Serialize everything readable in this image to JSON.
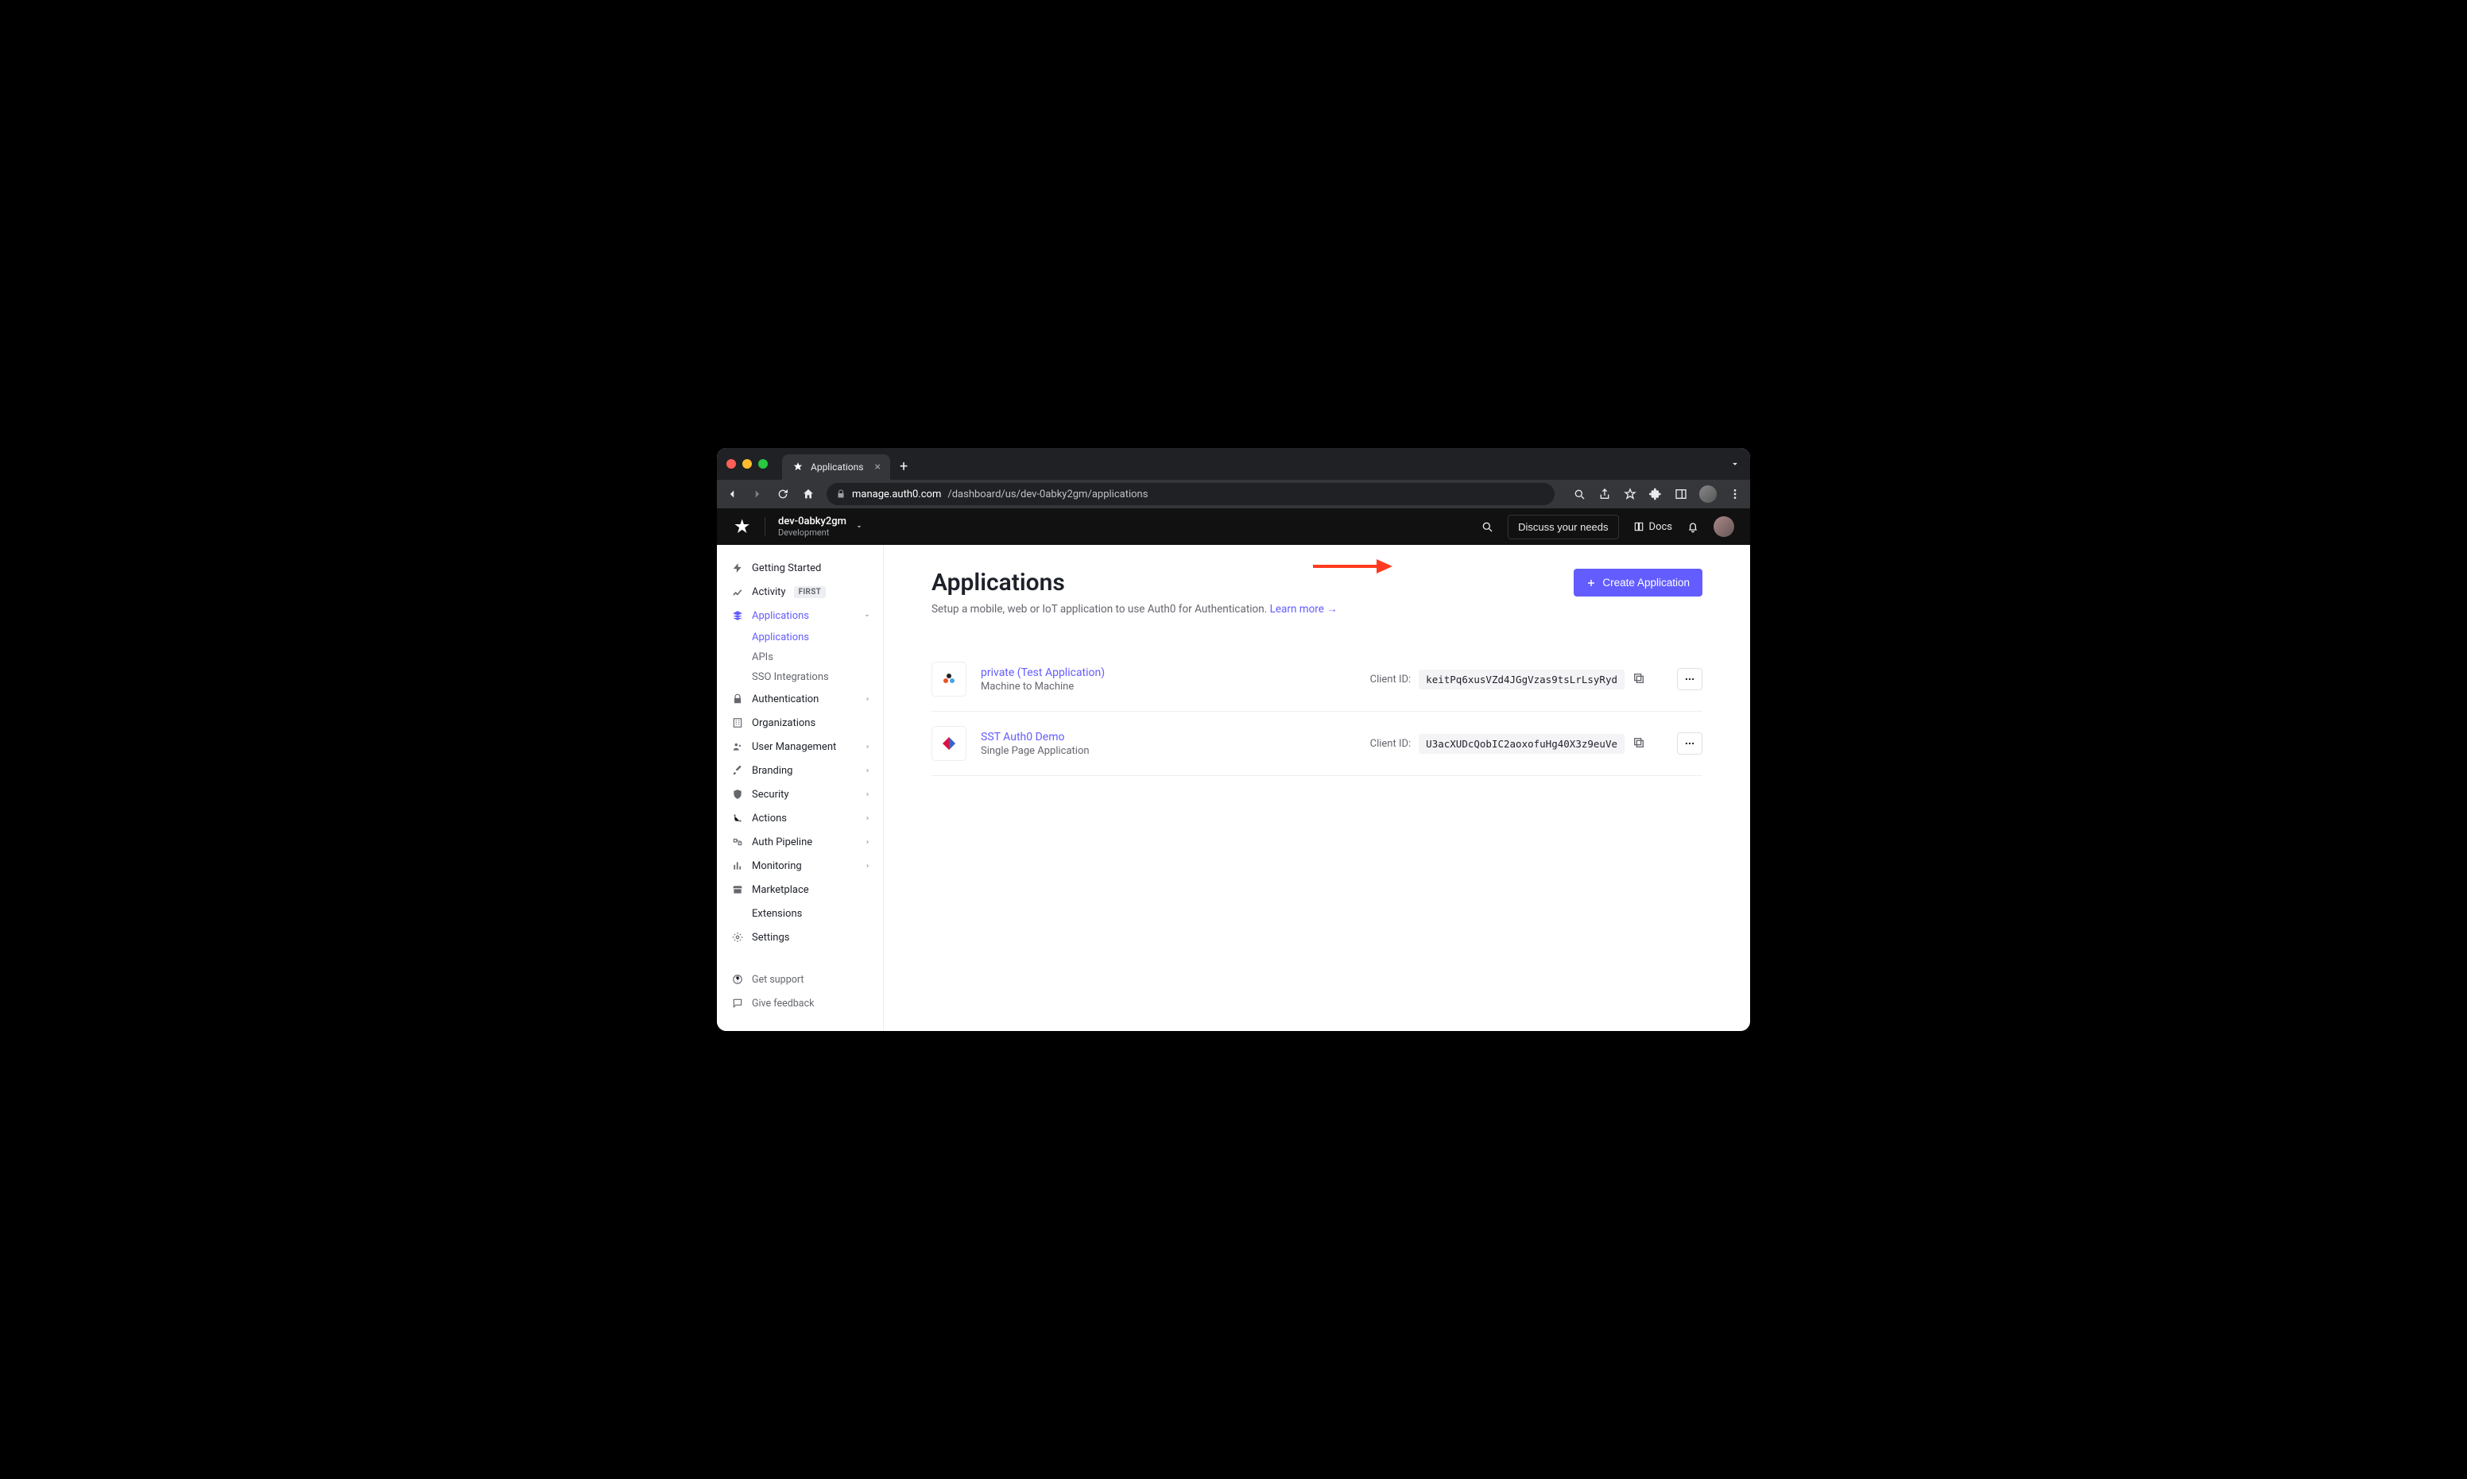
{
  "browser": {
    "tab_title": "Applications",
    "url_host": "manage.auth0.com",
    "url_path": "/dashboard/us/dev-0abky2gm/applications"
  },
  "header": {
    "tenant_name": "dev-0abky2gm",
    "tenant_env": "Development",
    "discuss_label": "Discuss your needs",
    "docs_label": "Docs"
  },
  "sidebar": {
    "items": [
      {
        "label": "Getting Started"
      },
      {
        "label": "Activity",
        "badge": "FIRST"
      },
      {
        "label": "Applications"
      },
      {
        "label": "Authentication"
      },
      {
        "label": "Organizations"
      },
      {
        "label": "User Management"
      },
      {
        "label": "Branding"
      },
      {
        "label": "Security"
      },
      {
        "label": "Actions"
      },
      {
        "label": "Auth Pipeline"
      },
      {
        "label": "Monitoring"
      },
      {
        "label": "Marketplace"
      },
      {
        "label": "Extensions"
      },
      {
        "label": "Settings"
      }
    ],
    "sub_applications": [
      {
        "label": "Applications"
      },
      {
        "label": "APIs"
      },
      {
        "label": "SSO Integrations"
      }
    ],
    "footer": {
      "support": "Get support",
      "feedback": "Give feedback"
    }
  },
  "page": {
    "title": "Applications",
    "subtitle": "Setup a mobile, web or IoT application to use Auth0 for Authentication.",
    "learn_more": "Learn more",
    "create_button": "Create Application",
    "client_id_label": "Client ID:",
    "apps": [
      {
        "name": "private (Test Application)",
        "type": "Machine to Machine",
        "client_id": "keitPq6xusVZd4JGgVzas9tsLrLsyRyd"
      },
      {
        "name": "SST Auth0 Demo",
        "type": "Single Page Application",
        "client_id": "U3acXUDcQobIC2aoxofuHg40X3z9euVe"
      }
    ]
  }
}
